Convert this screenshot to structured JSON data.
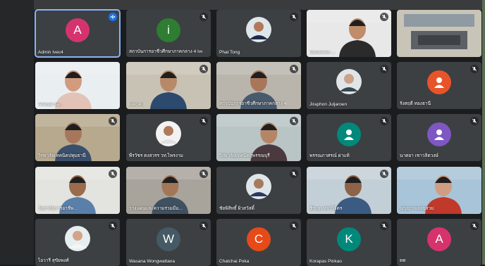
{
  "meeting": {
    "colors": {
      "tile": "#3c4043",
      "active_border": "#8ab4f8",
      "speaking": "#1a73e8",
      "background": "#1b1c1e"
    },
    "participants": [
      {
        "name": "Admin Ivec4",
        "initial": "A",
        "avatar_color": "#d6336c",
        "mic": "speaking"
      },
      {
        "name": "สถาบันการอาชีวศึกษาภาคกลาง 4 Ive...",
        "initial": "i",
        "avatar_color": "#2e7d32",
        "mic": "muted"
      },
      {
        "name": "Phat Tong",
        "initial": "",
        "avatar_color": "",
        "mic": "muted"
      },
      {
        "name": "kanokwan ...",
        "initial": "",
        "avatar_color": "",
        "mic": "muted"
      },
      {
        "name": "",
        "initial": "",
        "avatar_color": "",
        "mic": "none"
      },
      {
        "name": "Aranya Sa...",
        "initial": "",
        "avatar_color": "",
        "mic": "none"
      },
      {
        "name": "ivec 4 it",
        "initial": "",
        "avatar_color": "",
        "mic": "muted"
      },
      {
        "name": "สถาบันการอาชีวศึกษาภาคกลาง 4",
        "initial": "",
        "avatar_color": "",
        "mic": "muted"
      },
      {
        "name": "Jiraphon Juljaroen",
        "initial": "",
        "avatar_color": "",
        "mic": "muted"
      },
      {
        "name": "รังสฤดี ทองธานี",
        "initial": "",
        "avatar_color": "#e8542a",
        "mic": "muted"
      },
      {
        "name": "วิทยาลัยเทคนิคปทุมธานี",
        "initial": "",
        "avatar_color": "",
        "mic": "muted"
      },
      {
        "name": "พีรวัชร ตงสวรร วท.ไพรงาม",
        "initial": "",
        "avatar_color": "",
        "mic": "muted"
      },
      {
        "name": "วิทยาลัยเทคนิคสุพรรณบุรี",
        "initial": "",
        "avatar_color": "",
        "mic": "muted"
      },
      {
        "name": "พรรณภาศรณ์ ผ่าแท้",
        "initial": "",
        "avatar_color": "#00897b",
        "mic": "muted"
      },
      {
        "name": "นาตยา เชาวลิตวงษ์",
        "initial": "",
        "avatar_color": "#7e57c2",
        "mic": "muted"
      },
      {
        "name": "วิทยาลัยการอาชีพ...",
        "initial": "",
        "avatar_color": "",
        "mic": "muted"
      },
      {
        "name": "วางแผนและความร่วมมือ...",
        "initial": "",
        "avatar_color": "",
        "mic": "muted"
      },
      {
        "name": "ชัยพิสิทธิ์ ผิวสวัสดิ์",
        "initial": "",
        "avatar_color": "",
        "mic": "muted"
      },
      {
        "name": "ชีระยุ เหล่าวิจิตร",
        "initial": "",
        "avatar_color": "",
        "mic": "muted"
      },
      {
        "name": "บุญญา พลอยสวย",
        "initial": "",
        "avatar_color": "",
        "mic": "none"
      },
      {
        "name": "ไอวารี สุขัยพงศ์",
        "initial": "",
        "avatar_color": "",
        "mic": "muted"
      },
      {
        "name": "Wasana Wongwattana",
        "initial": "W",
        "avatar_color": "#455a64",
        "mic": "muted"
      },
      {
        "name": "Chatchai Poka",
        "initial": "C",
        "avatar_color": "#e64a19",
        "mic": "muted"
      },
      {
        "name": "Korapas Pinkao",
        "initial": "K",
        "avatar_color": "#00897b",
        "mic": "muted"
      },
      {
        "name": "ดด",
        "initial": "A",
        "avatar_color": "#d6336c",
        "mic": "muted"
      }
    ]
  }
}
